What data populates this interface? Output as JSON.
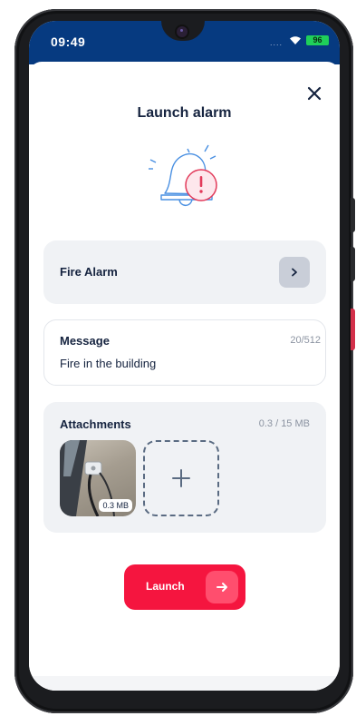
{
  "status": {
    "time": "09:49",
    "signal_dots": "....",
    "battery": "96"
  },
  "header": {
    "title": "Launch alarm",
    "close_icon": "close-icon"
  },
  "illustration": {
    "icon": "bell-alert-icon"
  },
  "alarm_type": {
    "label": "Fire Alarm",
    "chevron_icon": "chevron-right-icon"
  },
  "message": {
    "label": "Message",
    "counter": "20/512",
    "text": "Fire in the building"
  },
  "attachments": {
    "label": "Attachments",
    "size_used": "0.3 / 15 MB",
    "items": [
      {
        "size": "0.3 MB"
      }
    ],
    "add_icon": "plus-icon"
  },
  "launch": {
    "label": "Launch",
    "icon": "arrow-right-icon"
  },
  "colors": {
    "statusbar": "#063a80",
    "accent": "#f5153f",
    "card": "#f0f2f5",
    "text": "#15233f"
  }
}
